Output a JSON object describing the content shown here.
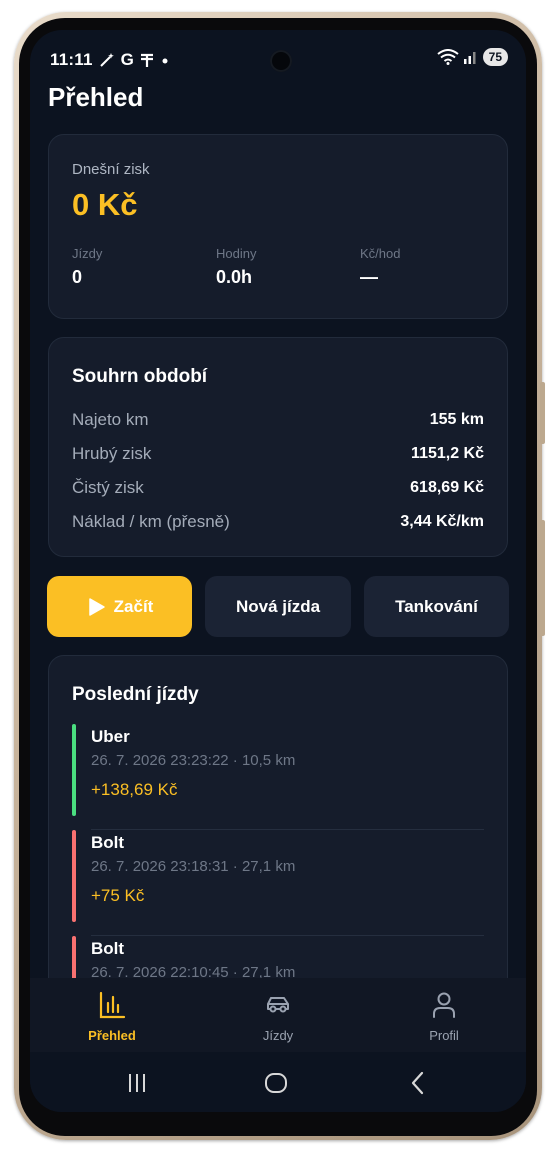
{
  "status_bar": {
    "time": "11:11",
    "left_icons": [
      "wand-icon",
      "google-icon",
      "antenna-icon",
      "dot-icon"
    ],
    "battery": "75"
  },
  "header": {
    "title": "Přehled"
  },
  "today": {
    "label": "Dnešní zisk",
    "amount": "0 Kč",
    "stats": [
      {
        "label": "Jízdy",
        "value": "0"
      },
      {
        "label": "Hodiny",
        "value": "0.0h"
      },
      {
        "label": "Kč/hod",
        "value": "—"
      }
    ]
  },
  "summary": {
    "title": "Souhrn období",
    "rows": [
      {
        "label": "Najeto km",
        "value": "155 km"
      },
      {
        "label": "Hrubý zisk",
        "value": "1151,2 Kč"
      },
      {
        "label": "Čistý zisk",
        "value": "618,69 Kč"
      },
      {
        "label": "Náklad / km (přesně)",
        "value": "3,44 Kč/km"
      }
    ]
  },
  "actions": {
    "start": "Začít",
    "new_ride": "Nová jízda",
    "refuel": "Tankování"
  },
  "recent": {
    "title": "Poslední jízdy",
    "rides": [
      {
        "name": "Uber",
        "meta": "26. 7. 2026 23:23:22 · 10,5 km",
        "amount": "+138,69 Kč",
        "color": "#4ade80"
      },
      {
        "name": "Bolt",
        "meta": "26. 7. 2026 23:18:31 · 27,1 km",
        "amount": "+75 Kč",
        "color": "#f87171"
      },
      {
        "name": "Bolt",
        "meta": "26. 7. 2026 22:10:45 · 27,1 km",
        "amount": "",
        "color": "#f87171"
      }
    ]
  },
  "nav": {
    "items": [
      {
        "label": "Přehled",
        "icon": "chart-icon",
        "active": true
      },
      {
        "label": "Jízdy",
        "icon": "car-icon",
        "active": false
      },
      {
        "label": "Profil",
        "icon": "person-icon",
        "active": false
      }
    ]
  },
  "colors": {
    "accent": "#fbbf24",
    "background": "#0c1320",
    "card": "#151c2b",
    "uber": "#4ade80",
    "bolt": "#f87171"
  }
}
